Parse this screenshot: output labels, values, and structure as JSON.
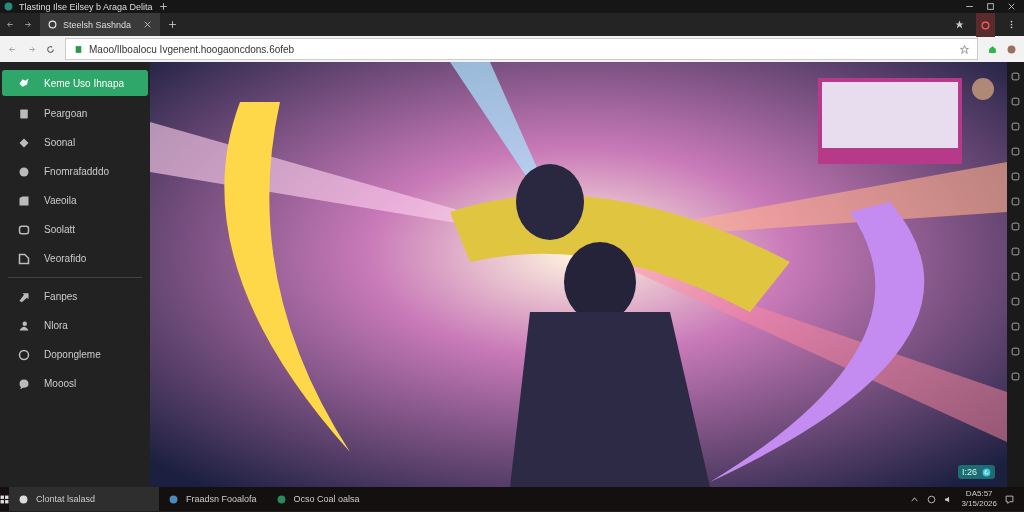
{
  "window": {
    "title": "Tlasting Ilse Eilsey b Araga Delita"
  },
  "tabs": [
    {
      "label": "Steelsh Sashnda",
      "selected": true
    }
  ],
  "address_bar": {
    "value": "Maoo/Ilboalocu Ivgenent.hoogaoncdons.6ofeb"
  },
  "sidebar": {
    "sections": [
      {
        "items": [
          {
            "label": "Keme Uso Ihnapa",
            "selected": true
          },
          {
            "label": "Peargoan",
            "selected": false
          },
          {
            "label": "Soonal",
            "selected": false
          },
          {
            "label": "Fnomrafadddo",
            "selected": false
          },
          {
            "label": "Vaeoila",
            "selected": false
          },
          {
            "label": "Soolatt",
            "selected": false
          },
          {
            "label": "Veorafido",
            "selected": false
          }
        ]
      },
      {
        "items": [
          {
            "label": "Fanpes",
            "selected": false
          },
          {
            "label": "Nlora",
            "selected": false
          },
          {
            "label": "Dopongleme",
            "selected": false
          },
          {
            "label": "Mooosl",
            "selected": false
          }
        ]
      }
    ]
  },
  "media": {
    "timer": "I:26"
  },
  "taskbar": {
    "items": [
      {
        "label": "Clontat lsalasd",
        "selected": true
      },
      {
        "label": "Fraadsn Fooalofa",
        "selected": false
      },
      {
        "label": "Ocso Coal oalsa",
        "selected": false
      }
    ],
    "time": "DA5:57",
    "date": "3/15/2026"
  }
}
